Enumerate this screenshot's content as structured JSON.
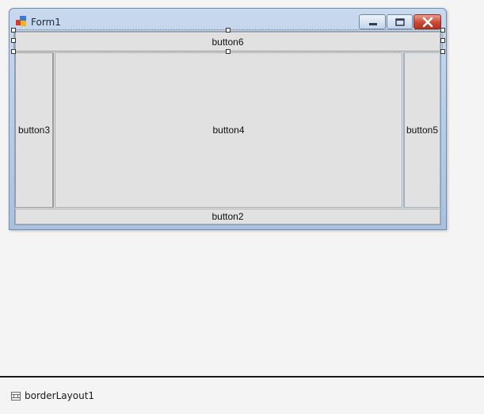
{
  "form": {
    "title": "Form1",
    "icon": "winforms-app-icon"
  },
  "caption_buttons": {
    "minimize_icon": "minimize-icon",
    "maximize_icon": "maximize-icon",
    "close_icon": "close-icon"
  },
  "buttons": {
    "top": "button6",
    "left": "button3",
    "center": "button4",
    "right": "button5",
    "bottom": "button2"
  },
  "component_tray": {
    "component_label": "borderLayout1",
    "component_icon": "layout-component-icon"
  },
  "colors": {
    "title_bar": "#a9c2e0",
    "close_button": "#c84b36",
    "button_face": "#e1e1e1",
    "designer_background": "#f4f4f4"
  }
}
